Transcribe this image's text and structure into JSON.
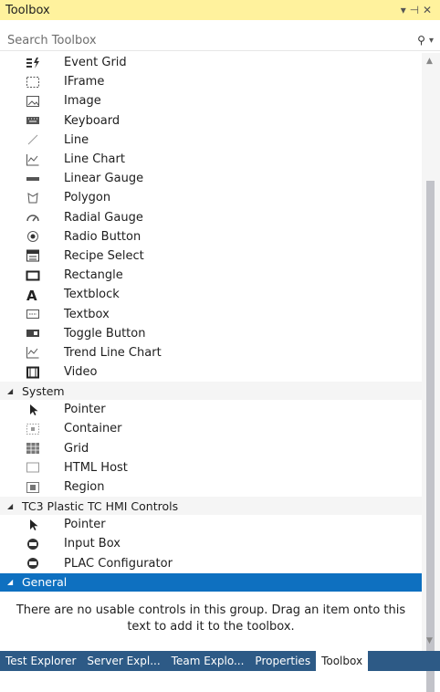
{
  "panel": {
    "title": "Toolbox",
    "pin_glyph": "▾ ⊣ ✕"
  },
  "search": {
    "placeholder": "Search Toolbox"
  },
  "items_top": [
    {
      "label": "Event Grid",
      "icon": "event-grid-icon"
    },
    {
      "label": "IFrame",
      "icon": "iframe-icon"
    },
    {
      "label": "Image",
      "icon": "image-icon"
    },
    {
      "label": "Keyboard",
      "icon": "keyboard-icon"
    },
    {
      "label": "Line",
      "icon": "line-icon"
    },
    {
      "label": "Line Chart",
      "icon": "line-chart-icon"
    },
    {
      "label": "Linear Gauge",
      "icon": "linear-gauge-icon"
    },
    {
      "label": "Polygon",
      "icon": "polygon-icon"
    },
    {
      "label": "Radial Gauge",
      "icon": "radial-gauge-icon"
    },
    {
      "label": "Radio Button",
      "icon": "radio-button-icon"
    },
    {
      "label": "Recipe Select",
      "icon": "recipe-select-icon"
    },
    {
      "label": "Rectangle",
      "icon": "rectangle-icon"
    },
    {
      "label": "Textblock",
      "icon": "textblock-icon"
    },
    {
      "label": "Textbox",
      "icon": "textbox-icon"
    },
    {
      "label": "Toggle Button",
      "icon": "toggle-button-icon"
    },
    {
      "label": "Trend Line Chart",
      "icon": "trend-line-chart-icon"
    },
    {
      "label": "Video",
      "icon": "video-icon"
    }
  ],
  "groups": {
    "system": {
      "label": "System",
      "items": [
        {
          "label": "Pointer",
          "icon": "pointer-icon"
        },
        {
          "label": "Container",
          "icon": "container-icon"
        },
        {
          "label": "Grid",
          "icon": "grid-icon"
        },
        {
          "label": "HTML Host",
          "icon": "html-host-icon"
        },
        {
          "label": "Region",
          "icon": "region-icon"
        }
      ]
    },
    "tc3": {
      "label": "TC3 Plastic TC HMI Controls",
      "items": [
        {
          "label": "Pointer",
          "icon": "pointer-icon"
        },
        {
          "label": "Input Box",
          "icon": "input-box-icon"
        },
        {
          "label": "PLAC Configurator",
          "icon": "plac-configurator-icon"
        }
      ]
    },
    "general": {
      "label": "General",
      "empty_message": "There are no usable controls in this group. Drag an item onto this text to add it to the toolbox."
    }
  },
  "tabs": [
    {
      "label": "Test Explorer",
      "active": false
    },
    {
      "label": "Server Expl...",
      "active": false
    },
    {
      "label": "Team Explo...",
      "active": false
    },
    {
      "label": "Properties",
      "active": false
    },
    {
      "label": "Toolbox",
      "active": true
    }
  ],
  "colors": {
    "title_bg": "#fff29d",
    "selected_group": "#0e70c0",
    "tab_bar": "#2d5a86"
  }
}
